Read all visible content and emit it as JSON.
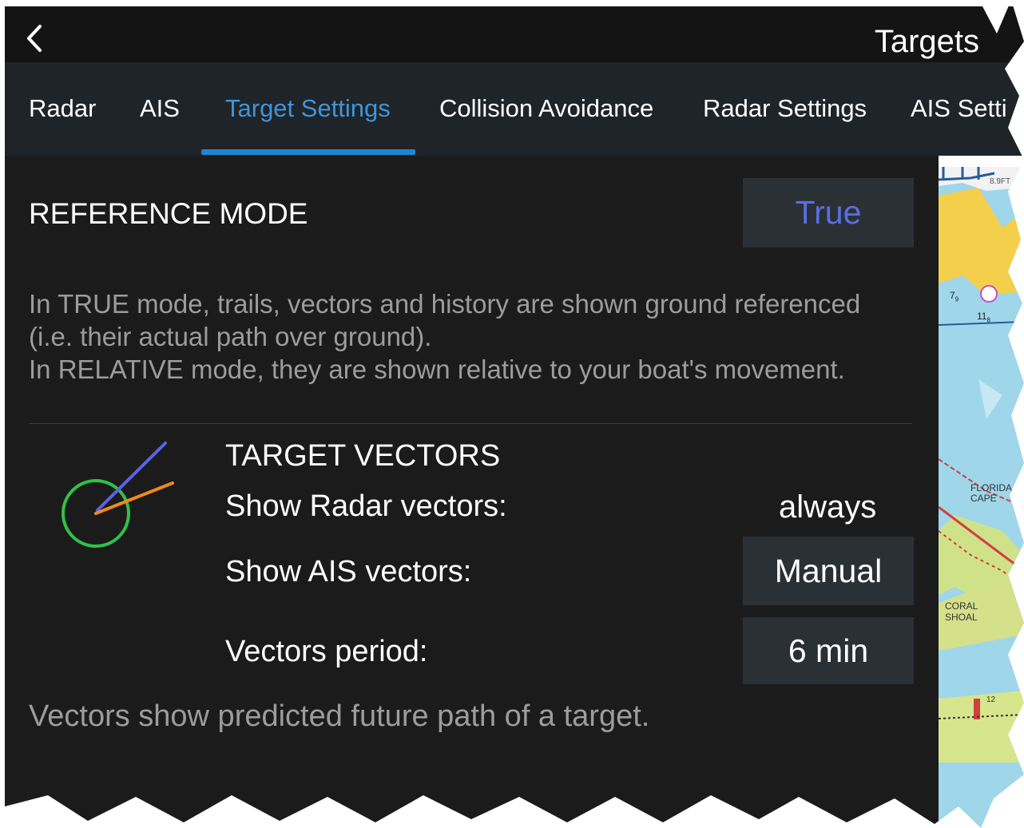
{
  "header": {
    "title": "Targets"
  },
  "tabs": [
    {
      "label": "Radar"
    },
    {
      "label": "AIS"
    },
    {
      "label": "Target Settings"
    },
    {
      "label": "Collision Avoidance"
    },
    {
      "label": "Radar Settings"
    },
    {
      "label": "AIS Setti"
    }
  ],
  "reference_mode": {
    "heading": "REFERENCE MODE",
    "value": "True",
    "description": [
      "In TRUE mode, trails, vectors and history are shown ground referenced",
      "(i.e. their actual path over ground).",
      "In RELATIVE mode, they are shown relative to your boat's movement."
    ]
  },
  "target_vectors": {
    "heading": "TARGET VECTORS",
    "radar_label": "Show Radar vectors:",
    "radar_value": "always",
    "ais_label": "Show AIS vectors:",
    "ais_value": "Manual",
    "period_label": "Vectors period:",
    "period_value": "6 min",
    "footer": "Vectors show predicted future path of a target."
  },
  "map": {
    "depth_marker": "8.9FT",
    "sounding_1": "7",
    "sounding_1_sub": "9",
    "sounding_2": "11",
    "sounding_2_sub": "8",
    "label_florida": "FLORIDA",
    "label_cape": "CAPE",
    "label_coral": "CORAL",
    "label_shoal": "SHOAL",
    "label_small": "12"
  },
  "colors": {
    "accent": "#3f95d8",
    "true_value": "#5a6ee0",
    "vector_circle": "#2fc24a",
    "vector_blue": "#5a62e8",
    "vector_orange": "#f08a1a"
  }
}
